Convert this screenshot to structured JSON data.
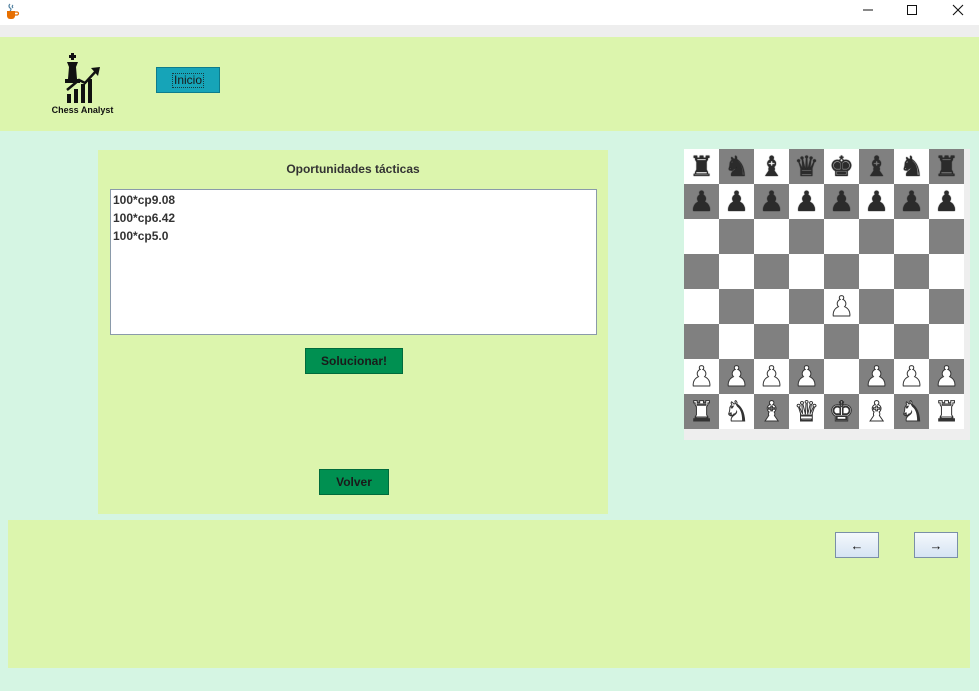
{
  "window": {
    "minimize_glyph": "—",
    "maximize_glyph": "☐",
    "close_glyph": "✕",
    "app_icon": "java-cup-icon"
  },
  "header": {
    "logo_text": "Chess Analyst",
    "logo_icon": "chess-king-growth-chart-icon",
    "inicio_label": "Inicio",
    "inicio_color": "#16a4b8"
  },
  "tactics_panel": {
    "title": "Oportunidades tácticas",
    "items": [
      "100*cp9.08",
      "100*cp6.42",
      "100*cp5.0"
    ],
    "solve_button": "Solucionar!",
    "back_button": "Volver",
    "button_color": "#009051"
  },
  "board": {
    "light_color": "#ffffff",
    "dark_color": "#808080",
    "rows": [
      [
        "br",
        "bn",
        "bb",
        "bq",
        "bk",
        "bb",
        "bn",
        "br"
      ],
      [
        "bp",
        "bp",
        "bp",
        "bp",
        "bp",
        "bp",
        "bp",
        "bp"
      ],
      [
        "",
        "",
        "",
        "",
        "",
        "",
        "",
        ""
      ],
      [
        "",
        "",
        "",
        "",
        "",
        "",
        "",
        ""
      ],
      [
        "",
        "",
        "",
        "",
        "wp",
        "",
        "",
        ""
      ],
      [
        "",
        "",
        "",
        "",
        "",
        "",
        "",
        ""
      ],
      [
        "wp",
        "wp",
        "wp",
        "wp",
        "",
        "wp",
        "wp",
        "wp"
      ],
      [
        "wr",
        "wn",
        "wb",
        "wq",
        "wk",
        "wb",
        "wn",
        "wr"
      ]
    ]
  },
  "footer": {
    "prev_label": "←",
    "next_label": "→"
  },
  "colors": {
    "background": "#d5f5e3",
    "panel": "#dcf5ad"
  }
}
